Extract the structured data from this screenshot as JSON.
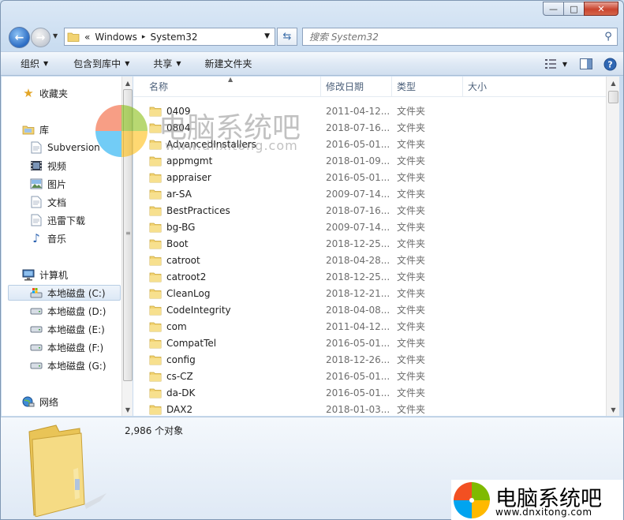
{
  "window": {
    "caption": {
      "minimize": "—",
      "maximize": "□",
      "close": "✕"
    }
  },
  "address": {
    "overflow": "«",
    "crumbs": [
      "Windows",
      "System32"
    ],
    "separator": "▸"
  },
  "search": {
    "placeholder": "搜索 System32"
  },
  "toolbar": {
    "organize": "组织",
    "include_in_library": "包含到库中",
    "share": "共享",
    "new_folder": "新建文件夹"
  },
  "nav": {
    "favorites": "收藏夹",
    "libraries": "库",
    "lib_items": [
      "Subversion",
      "视频",
      "图片",
      "文档",
      "迅雷下载",
      "音乐"
    ],
    "computer": "计算机",
    "drives": [
      "本地磁盘 (C:)",
      "本地磁盘 (D:)",
      "本地磁盘 (E:)",
      "本地磁盘 (F:)",
      "本地磁盘 (G:)"
    ],
    "network": "网络"
  },
  "columns": {
    "name": "名称",
    "date": "修改日期",
    "type": "类型",
    "size": "大小"
  },
  "files": [
    {
      "name": "0409",
      "date": "2011-04-12...",
      "type": "文件夹"
    },
    {
      "name": "0804",
      "date": "2018-07-16...",
      "type": "文件夹"
    },
    {
      "name": "AdvancedInstallers",
      "date": "2016-05-01...",
      "type": "文件夹"
    },
    {
      "name": "appmgmt",
      "date": "2018-01-09...",
      "type": "文件夹"
    },
    {
      "name": "appraiser",
      "date": "2016-05-01...",
      "type": "文件夹"
    },
    {
      "name": "ar-SA",
      "date": "2009-07-14...",
      "type": "文件夹"
    },
    {
      "name": "BestPractices",
      "date": "2018-07-16...",
      "type": "文件夹"
    },
    {
      "name": "bg-BG",
      "date": "2009-07-14...",
      "type": "文件夹"
    },
    {
      "name": "Boot",
      "date": "2018-12-25...",
      "type": "文件夹"
    },
    {
      "name": "catroot",
      "date": "2018-04-28...",
      "type": "文件夹"
    },
    {
      "name": "catroot2",
      "date": "2018-12-25...",
      "type": "文件夹"
    },
    {
      "name": "CleanLog",
      "date": "2018-12-21...",
      "type": "文件夹"
    },
    {
      "name": "CodeIntegrity",
      "date": "2018-04-08...",
      "type": "文件夹"
    },
    {
      "name": "com",
      "date": "2011-04-12...",
      "type": "文件夹"
    },
    {
      "name": "CompatTel",
      "date": "2016-05-01...",
      "type": "文件夹"
    },
    {
      "name": "config",
      "date": "2018-12-26...",
      "type": "文件夹"
    },
    {
      "name": "cs-CZ",
      "date": "2016-05-01...",
      "type": "文件夹"
    },
    {
      "name": "da-DK",
      "date": "2016-05-01...",
      "type": "文件夹"
    },
    {
      "name": "DAX2",
      "date": "2018-01-03...",
      "type": "文件夹"
    }
  ],
  "status": {
    "count": "2,986 个对象"
  },
  "watermark": {
    "text": "电脑系统吧",
    "url": "www.dnxitong.com"
  },
  "colors": {
    "accent": "#3a6da8",
    "folder": "#f2d372",
    "selection": "#dde9f6"
  }
}
